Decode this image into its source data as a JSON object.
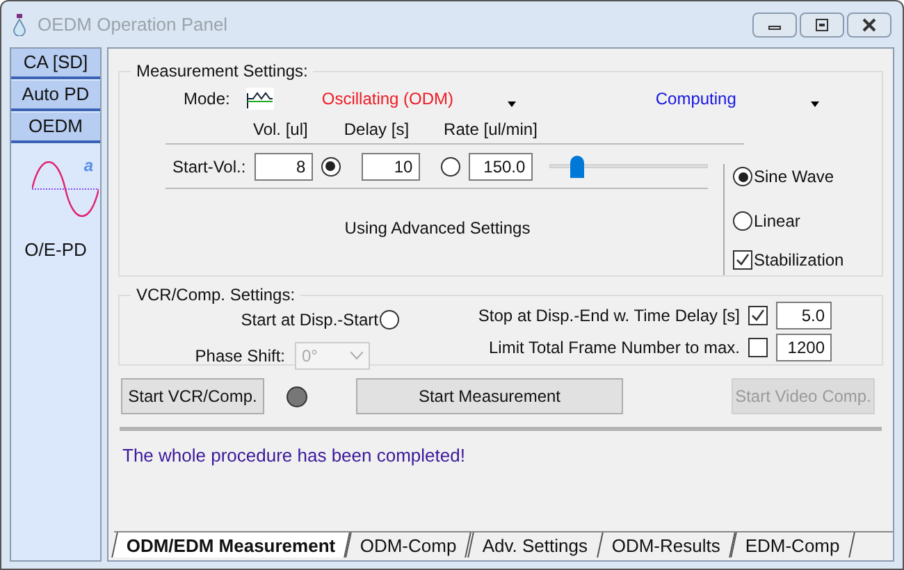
{
  "window": {
    "title": "OEDM Operation Panel"
  },
  "sidebar": {
    "items": [
      {
        "label": "CA [SD]"
      },
      {
        "label": "Auto PD"
      },
      {
        "label": "OEDM"
      }
    ],
    "badge": "a",
    "caption": "O/E-PD"
  },
  "measurement": {
    "title": "Measurement Settings:",
    "mode_label": "Mode:",
    "mode_value": "Oscillating (ODM)",
    "computing": "Computing",
    "headers": [
      "Vol. [ul]",
      "Delay [s]",
      "Rate [ul/min]"
    ],
    "row_label": "Start-Vol.:",
    "volume": "8",
    "volume_selected": true,
    "delay": "10",
    "delay_selected": false,
    "rate": "150.0",
    "rate_slider": {
      "level": 0.18
    },
    "waves": [
      {
        "label": "Sine Wave",
        "selected": true
      },
      {
        "label": "Linear",
        "selected": false
      }
    ],
    "stabilization": {
      "label": "Stabilization",
      "checked": true
    },
    "advanced": "Using Advanced Settings"
  },
  "vcr": {
    "title": "VCR/Comp. Settings:",
    "start_at_disp": {
      "label": "Start at Disp.-Start",
      "selected": false
    },
    "phase_label": "Phase Shift:",
    "phase_value": "0°",
    "phase_disabled": true,
    "stop_at_disp": {
      "label": "Stop at Disp.-End w. Time Delay [s]",
      "checked": true,
      "value": "5.0"
    },
    "limit_frames": {
      "label": "Limit Total Frame Number to max.",
      "checked": false,
      "value": "1200"
    }
  },
  "buttons": [
    {
      "label": "Start VCR/Comp.",
      "disabled": false
    },
    {
      "label": "Start Measurement",
      "disabled": false
    },
    {
      "label": "Start Video Comp.",
      "disabled": true
    }
  ],
  "status": "The whole procedure has been completed!",
  "tabs": [
    {
      "label": "ODM/EDM Measurement",
      "selected": true
    },
    {
      "label": "ODM-Comp",
      "selected": false
    },
    {
      "label": "Adv. Settings",
      "selected": false
    },
    {
      "label": "ODM-Results",
      "selected": false
    },
    {
      "label": "EDM-Comp",
      "selected": false
    }
  ]
}
